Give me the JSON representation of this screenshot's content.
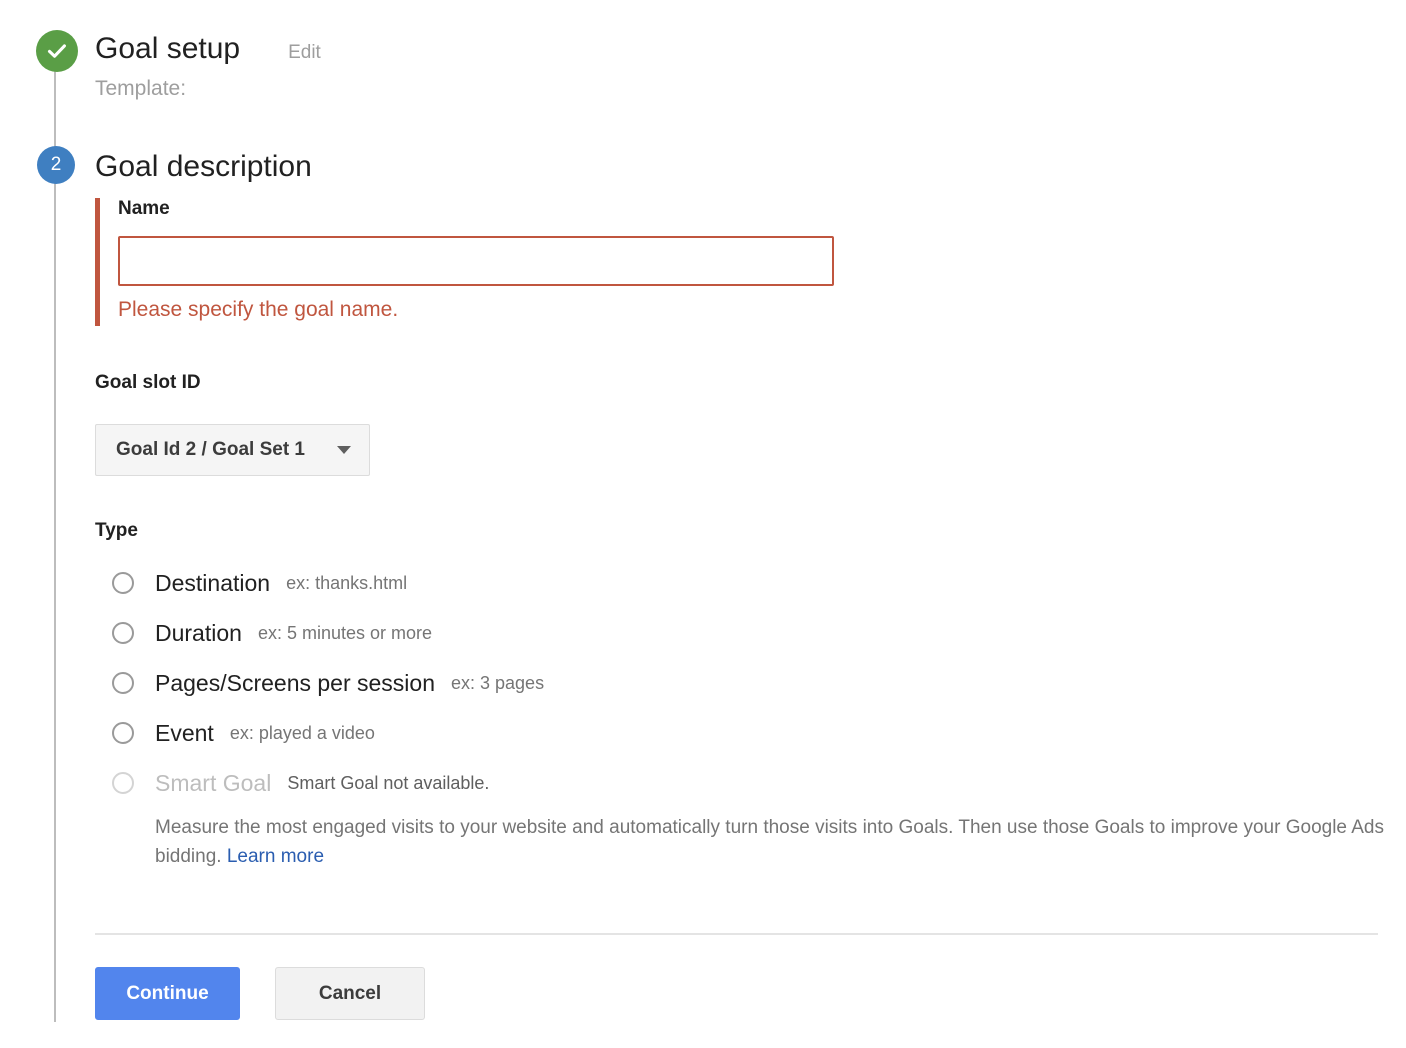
{
  "stepper": {
    "step1_status_icon": "check-circle-icon",
    "step2_number": "2"
  },
  "step1": {
    "title": "Goal setup",
    "edit_label": "Edit",
    "template_label": "Template:"
  },
  "step2": {
    "title": "Goal description",
    "name": {
      "label": "Name",
      "value": "",
      "placeholder": "",
      "error_message": "Please specify the goal name."
    },
    "goal_slot": {
      "label": "Goal slot ID",
      "selected": "Goal Id 2 / Goal Set 1",
      "caret_icon": "chevron-down-icon"
    },
    "type": {
      "label": "Type",
      "options": [
        {
          "label": "Destination",
          "example": "ex: thanks.html",
          "selected": false,
          "disabled": false
        },
        {
          "label": "Duration",
          "example": "ex: 5 minutes or more",
          "selected": false,
          "disabled": false
        },
        {
          "label": "Pages/Screens per session",
          "example": "ex: 3 pages",
          "selected": false,
          "disabled": false
        },
        {
          "label": "Event",
          "example": "ex: played a video",
          "selected": false,
          "disabled": false
        },
        {
          "label": "Smart Goal",
          "example": "Smart Goal not available.",
          "selected": false,
          "disabled": true
        }
      ],
      "smart_goal_description": "Measure the most engaged visits to your website and automatically turn those visits into Goals. Then use those Goals to improve your Google Ads bidding.",
      "learn_more_label": "Learn more"
    }
  },
  "actions": {
    "continue_label": "Continue",
    "cancel_label": "Cancel"
  },
  "colors": {
    "step_done": "#5a9e46",
    "step_current": "#3f7fc1",
    "error": "#c0563f",
    "primary_button": "#5285ed",
    "link": "#2a5db0"
  }
}
